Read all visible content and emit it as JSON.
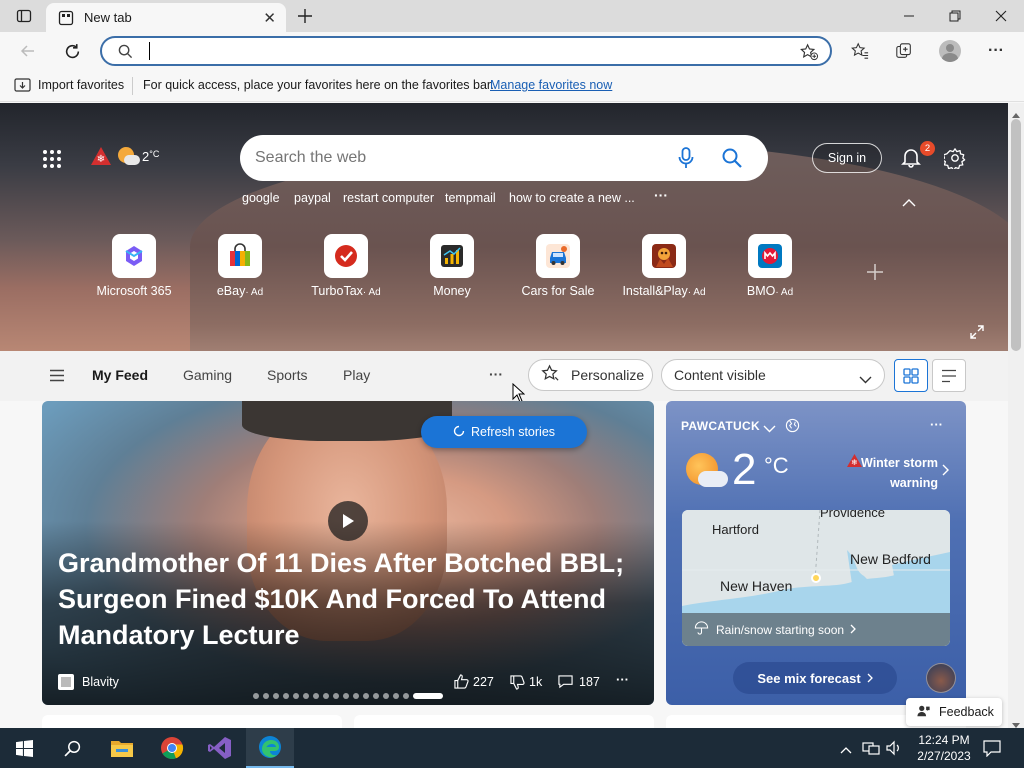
{
  "browser": {
    "tab_title": "New tab",
    "address_value": "",
    "favorites_bar": {
      "import_label": "Import favorites",
      "message": "For quick access, place your favorites here on the favorites bar.",
      "manage_link": "Manage favorites now"
    }
  },
  "hero": {
    "temperature": "2",
    "temperature_unit": "°C",
    "search_placeholder": "Search the web",
    "sign_in_label": "Sign in",
    "notification_count": "2",
    "suggestions": [
      "google",
      "paypal",
      "restart computer",
      "tempmail",
      "how to create a new ..."
    ],
    "more_label": "···",
    "quick_links": [
      {
        "label": "Microsoft 365",
        "ad": ""
      },
      {
        "label": "eBay",
        "ad": "· Ad"
      },
      {
        "label": "TurboTax",
        "ad": "· Ad"
      },
      {
        "label": "Money",
        "ad": ""
      },
      {
        "label": "Cars for Sale",
        "ad": ""
      },
      {
        "label": "Install&Play",
        "ad": "· Ad"
      },
      {
        "label": "BMO",
        "ad": "· Ad"
      }
    ]
  },
  "feed_nav": {
    "tabs": [
      "My Feed",
      "Gaming",
      "Sports",
      "Play"
    ],
    "more_label": "···",
    "personalize_label": "Personalize",
    "content_visible_label": "Content visible"
  },
  "main_card": {
    "refresh_label": "Refresh stories",
    "headline": "Grandmother Of 11 Dies After Botched BBL; Surgeon Fined $10K And Forced To Attend Mandatory Lecture",
    "source": "Blavity",
    "likes": "227",
    "dislikes": "1k",
    "comments": "187",
    "more_label": "···"
  },
  "weather_card": {
    "location": "PAWCATUCK",
    "temperature": "2",
    "unit": "°C",
    "alert": "Winter storm warning",
    "map_labels": [
      "Hartford",
      "Providence",
      "New Bedford",
      "New Haven"
    ],
    "rain_text": "Rain/snow starting soon",
    "forecast_label": "See mix forecast",
    "more_label": "···"
  },
  "feedback_label": "Feedback",
  "taskbar": {
    "time": "12:24 PM",
    "date": "2/27/2023"
  },
  "colors": {
    "accent": "#0f6cbd",
    "link": "#1a5fb4",
    "taskbar": "#1c2b38",
    "weather_card": "#4f70b3",
    "refresh_pill": "#1b74d6"
  }
}
